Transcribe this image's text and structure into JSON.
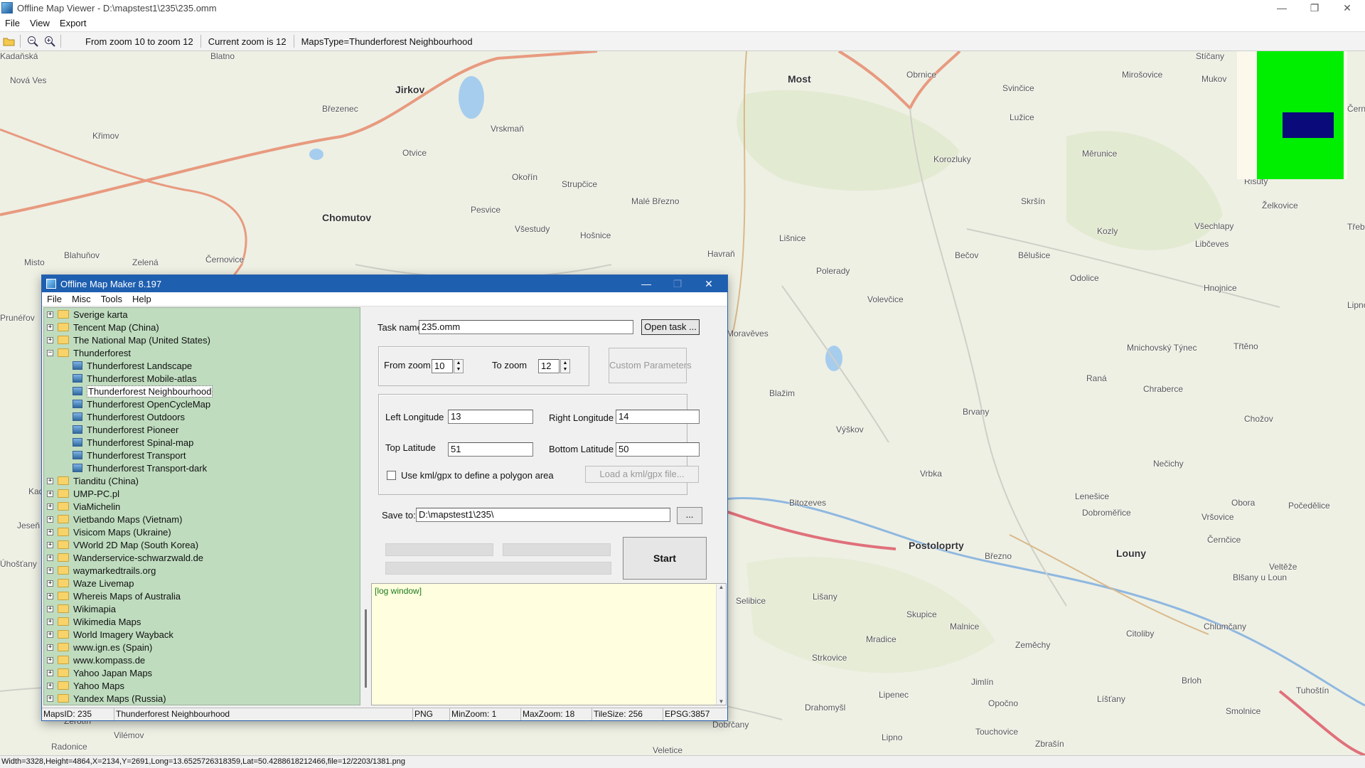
{
  "window": {
    "title": "Offline Map Viewer - D:\\mapstest1\\235\\235.omm",
    "minimize": "—",
    "maximize": "❐",
    "close": "✕"
  },
  "menu": [
    "File",
    "View",
    "Export"
  ],
  "toolbar": {
    "zoom_range": "From zoom 10 to zoom 12",
    "current_zoom": "Current zoom is 12",
    "maps_type": "MapsType=Thunderforest Neighbourhood"
  },
  "map": {
    "places": [
      {
        "name": "Jirkov",
        "big": true
      },
      {
        "name": "Most",
        "big": true
      },
      {
        "name": "Chomutov",
        "big": true
      },
      {
        "name": "Postoloprty",
        "big": true
      },
      {
        "name": "Louny",
        "big": true
      },
      {
        "name": "Březenec"
      },
      {
        "name": "Vrskmaň"
      },
      {
        "name": "Otvice"
      },
      {
        "name": "Křimov"
      },
      {
        "name": "Okořín"
      },
      {
        "name": "Strupčice"
      },
      {
        "name": "Pesvice"
      },
      {
        "name": "Malé Březno"
      },
      {
        "name": "Všestudy"
      },
      {
        "name": "Hošnice"
      },
      {
        "name": "Obrnice"
      },
      {
        "name": "Svinčice"
      },
      {
        "name": "Mirošovice"
      },
      {
        "name": "Mukov"
      },
      {
        "name": "Lužice"
      },
      {
        "name": "Korozluky"
      },
      {
        "name": "Měrunice"
      },
      {
        "name": "Skršín"
      },
      {
        "name": "Želkovice"
      },
      {
        "name": "Všechlapy"
      },
      {
        "name": "Libčeves"
      },
      {
        "name": "Kozly"
      },
      {
        "name": "Bělušice"
      },
      {
        "name": "Odolice"
      },
      {
        "name": "Hnojnice"
      },
      {
        "name": "Bečov"
      },
      {
        "name": "Lišnice"
      },
      {
        "name": "Polerady"
      },
      {
        "name": "Havraň"
      },
      {
        "name": "Volevčice"
      },
      {
        "name": "Moravěves"
      },
      {
        "name": "Mnichovský Týnec"
      },
      {
        "name": "Třtěno"
      },
      {
        "name": "Raná"
      },
      {
        "name": "Blažim"
      },
      {
        "name": "Chraberce"
      },
      {
        "name": "Chožov"
      },
      {
        "name": "Brvany"
      },
      {
        "name": "Výškov"
      },
      {
        "name": "Nečichy"
      },
      {
        "name": "Vrbka"
      },
      {
        "name": "Lenešice"
      },
      {
        "name": "Obora"
      },
      {
        "name": "Počedělice"
      },
      {
        "name": "Bitozeves"
      },
      {
        "name": "Dobroměřice"
      },
      {
        "name": "Vršovice"
      },
      {
        "name": "Černčice"
      },
      {
        "name": "Březno"
      },
      {
        "name": "Veltěže"
      },
      {
        "name": "Selibice"
      },
      {
        "name": "Lišany"
      },
      {
        "name": "Blšany u Loun"
      },
      {
        "name": "Skupice"
      },
      {
        "name": "Malnice"
      },
      {
        "name": "Citoliby"
      },
      {
        "name": "Chlumčany"
      },
      {
        "name": "Mradice"
      },
      {
        "name": "Zeměchy"
      },
      {
        "name": "Strkovice"
      },
      {
        "name": "Jimlín"
      },
      {
        "name": "Brloh"
      },
      {
        "name": "Tuhoštín"
      },
      {
        "name": "Lipenec"
      },
      {
        "name": "Opočno"
      },
      {
        "name": "Líšťany"
      },
      {
        "name": "Smolnice"
      },
      {
        "name": "Drahomyšl"
      },
      {
        "name": "Touchovice"
      },
      {
        "name": "Lipno"
      },
      {
        "name": "Zbrašín"
      },
      {
        "name": "Blahuňov"
      },
      {
        "name": "Zelená"
      },
      {
        "name": "Černovice"
      },
      {
        "name": "Misto"
      },
      {
        "name": "Nová Ves"
      },
      {
        "name": "Prunéřov"
      },
      {
        "name": "Radonice"
      },
      {
        "name": "Vilémov"
      },
      {
        "name": "Veletice"
      },
      {
        "name": "Dobřčany"
      },
      {
        "name": "Žerotín"
      },
      {
        "name": "Kadaň"
      },
      {
        "name": "Jeseň"
      },
      {
        "name": "Úhošťany"
      },
      {
        "name": "Řisuty"
      },
      {
        "name": "Černé Újezd"
      },
      {
        "name": "Třebívlice"
      },
      {
        "name": "Lipno"
      },
      {
        "name": "Blatno"
      },
      {
        "name": "Stíčany"
      },
      {
        "name": "Kadaňská"
      }
    ],
    "overview": {
      "frame_color": "#00ee00",
      "view_color": "#0a0a7a"
    }
  },
  "statusbar": "Width=3328,Height=4864,X=2134,Y=2691,Long=13.6525726318359,Lat=50.4288618212466,file=12/2203/1381.png",
  "dialog": {
    "title": "Offline Map Maker 8.197",
    "menu": [
      "File",
      "Misc",
      "Tools",
      "Help"
    ],
    "tree": [
      {
        "label": "Sverige karta",
        "type": "folder",
        "expanded": false
      },
      {
        "label": "Tencent Map (China)",
        "type": "folder",
        "expanded": false
      },
      {
        "label": "The National Map (United States)",
        "type": "folder",
        "expanded": false
      },
      {
        "label": "Thunderforest",
        "type": "folder",
        "expanded": true
      },
      {
        "label": "Thunderforest Landscape",
        "type": "map"
      },
      {
        "label": "Thunderforest Mobile-atlas",
        "type": "map"
      },
      {
        "label": "Thunderforest Neighbourhood",
        "type": "map",
        "selected": true
      },
      {
        "label": "Thunderforest OpenCycleMap",
        "type": "map"
      },
      {
        "label": "Thunderforest Outdoors",
        "type": "map"
      },
      {
        "label": "Thunderforest Pioneer",
        "type": "map"
      },
      {
        "label": "Thunderforest Spinal-map",
        "type": "map"
      },
      {
        "label": "Thunderforest Transport",
        "type": "map"
      },
      {
        "label": "Thunderforest Transport-dark",
        "type": "map"
      },
      {
        "label": "Tianditu (China)",
        "type": "folder",
        "expanded": false
      },
      {
        "label": "UMP-PC.pl",
        "type": "folder",
        "expanded": false
      },
      {
        "label": "ViaMichelin",
        "type": "folder",
        "expanded": false
      },
      {
        "label": "Vietbando Maps (Vietnam)",
        "type": "folder",
        "expanded": false
      },
      {
        "label": "Visicom Maps (Ukraine)",
        "type": "folder",
        "expanded": false
      },
      {
        "label": "VWorld 2D Map (South Korea)",
        "type": "folder",
        "expanded": false
      },
      {
        "label": "Wanderservice-schwarzwald.de",
        "type": "folder",
        "expanded": false
      },
      {
        "label": "waymarkedtrails.org",
        "type": "folder",
        "expanded": false
      },
      {
        "label": "Waze Livemap",
        "type": "folder",
        "expanded": false
      },
      {
        "label": "Whereis Maps of Australia",
        "type": "folder",
        "expanded": false
      },
      {
        "label": "Wikimapia",
        "type": "folder",
        "expanded": false
      },
      {
        "label": "Wikimedia Maps",
        "type": "folder",
        "expanded": false
      },
      {
        "label": "World Imagery Wayback",
        "type": "folder",
        "expanded": false
      },
      {
        "label": "www.ign.es (Spain)",
        "type": "folder",
        "expanded": false
      },
      {
        "label": "www.kompass.de",
        "type": "folder",
        "expanded": false
      },
      {
        "label": "Yahoo Japan Maps",
        "type": "folder",
        "expanded": false
      },
      {
        "label": "Yahoo Maps",
        "type": "folder",
        "expanded": false
      },
      {
        "label": "Yandex Maps (Russia)",
        "type": "folder",
        "expanded": false
      }
    ],
    "form": {
      "task_name_label": "Task name",
      "task_name": "235.omm",
      "open_task": "Open task ...",
      "from_zoom_label": "From zoom",
      "from_zoom": "10",
      "to_zoom_label": "To zoom",
      "to_zoom": "12",
      "custom_params": "Custom Parameters",
      "left_lon_label": "Left Longitude",
      "left_lon": "13",
      "right_lon_label": "Right Longitude",
      "right_lon": "14",
      "top_lat_label": "Top Latitude",
      "top_lat": "51",
      "bottom_lat_label": "Bottom Latitude",
      "bottom_lat": "50",
      "kml_label": "Use kml/gpx to define a polygon area",
      "load_kml": "Load a kml/gpx file...",
      "save_to_label": "Save to:",
      "save_to": "D:\\mapstest1\\235\\",
      "browse": "...",
      "start": "Start",
      "log": "[log window]"
    },
    "status": {
      "maps_id": "MapsID: 235",
      "map_name": "Thunderforest Neighbourhood",
      "format": "PNG",
      "min_zoom": "MinZoom: 1",
      "max_zoom": "MaxZoom: 18",
      "tile_size": "TileSize: 256",
      "epsg": "EPSG:3857"
    }
  }
}
